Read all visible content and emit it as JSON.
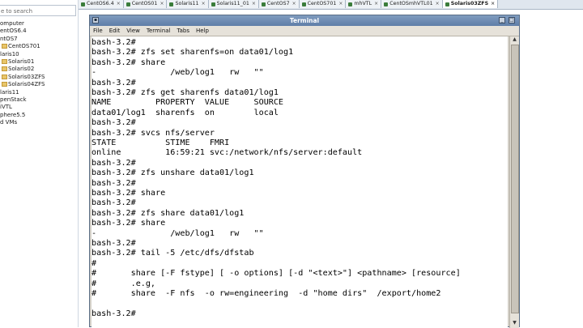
{
  "sidebar": {
    "search_placeholder": "e to search",
    "items": [
      {
        "label": "omputer",
        "folder": false
      },
      {
        "label": "entOS6.4",
        "folder": false
      },
      {
        "label": "ntOS7",
        "folder": false
      },
      {
        "label": "CentOS701",
        "folder": true
      },
      {
        "label": "laris10",
        "folder": false
      },
      {
        "label": "Solaris01",
        "folder": true
      },
      {
        "label": "Solaris02",
        "folder": true
      },
      {
        "label": "Solaris03ZFS",
        "folder": true
      },
      {
        "label": "Solaris04ZFS",
        "folder": true
      },
      {
        "label": "laris11",
        "folder": false
      },
      {
        "label": "penStack",
        "folder": false
      },
      {
        "label": "iVTL",
        "folder": false
      },
      {
        "label": "phere5.5",
        "folder": false
      },
      {
        "label": "d VMs",
        "folder": false
      }
    ]
  },
  "tabs": [
    {
      "label": "CentOS6.4",
      "active": false
    },
    {
      "label": "CentOS01",
      "active": false
    },
    {
      "label": "Solaris11",
      "active": false
    },
    {
      "label": "Solaris11_01",
      "active": false
    },
    {
      "label": "CentOS7",
      "active": false
    },
    {
      "label": "CentOS701",
      "active": false
    },
    {
      "label": "mhVTL",
      "active": false
    },
    {
      "label": "CentOSmhVTL01",
      "active": false
    },
    {
      "label": "Solaris03ZFS",
      "active": true
    }
  ],
  "terminal": {
    "title": "Terminal",
    "menu": [
      "File",
      "Edit",
      "View",
      "Terminal",
      "Tabs",
      "Help"
    ],
    "lines": [
      "bash-3.2#",
      "bash-3.2# zfs set sharenfs=on data01/log1",
      "bash-3.2# share",
      "-               /web/log1   rw   \"\"",
      "bash-3.2#",
      "bash-3.2# zfs get sharenfs data01/log1",
      "NAME         PROPERTY  VALUE     SOURCE",
      "data01/log1  sharenfs  on        local",
      "bash-3.2#",
      "bash-3.2# svcs nfs/server",
      "STATE          STIME    FMRI",
      "online         16:59:21 svc:/network/nfs/server:default",
      "bash-3.2#",
      "bash-3.2# zfs unshare data01/log1",
      "bash-3.2#",
      "bash-3.2# share",
      "bash-3.2#",
      "bash-3.2# zfs share data01/log1",
      "bash-3.2# share",
      "-               /web/log1   rw   \"\"",
      "bash-3.2#",
      "bash-3.2# tail -5 /etc/dfs/dfstab",
      "#",
      "#       share [-F fstype] [ -o options] [-d \"<text>\"] <pathname> [resource]",
      "#       .e.g,",
      "#       share  -F nfs  -o rw=engineering  -d \"home dirs\"  /export/home2",
      "",
      "bash-3.2#"
    ]
  },
  "colors": {
    "titlebar": "#6a88b2",
    "terminal_bg": "#ffffff",
    "terminal_fg": "#000000"
  }
}
